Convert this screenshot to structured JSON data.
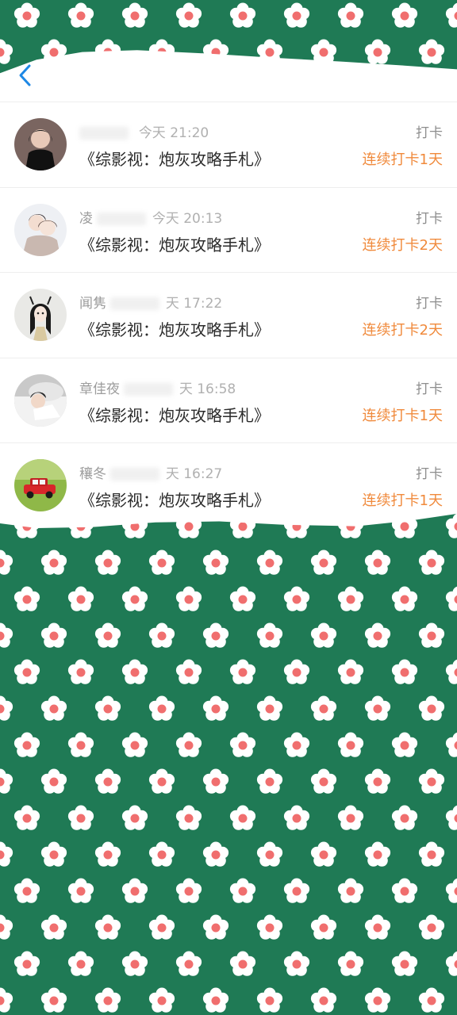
{
  "colors": {
    "background": "#1f7a55",
    "flower_petal": "#ffffff",
    "flower_center": "#f06e6e",
    "accent": "#f08a3c",
    "back_arrow": "#1e88e5"
  },
  "header": {
    "back_icon": "chevron-left-icon"
  },
  "list": [
    {
      "name": "",
      "time": "今天 21:20",
      "book": "《综影视：炮灰攻略手札》",
      "action": "打卡",
      "streak": "连续打卡1天",
      "avatar": "woman-portrait"
    },
    {
      "name": "凌",
      "time": "今天 20:13",
      "book": "《综影视：炮灰攻略手札》",
      "action": "打卡",
      "streak": "连续打卡2天",
      "avatar": "couple-illustration"
    },
    {
      "name": "闻隽",
      "time": "天 17:22",
      "book": "《综影视：炮灰攻略手札》",
      "action": "打卡",
      "streak": "连续打卡2天",
      "avatar": "girl-illustration"
    },
    {
      "name": "章佳夜",
      "time": "天 16:58",
      "book": "《综影视：炮灰攻略手札》",
      "action": "打卡",
      "streak": "连续打卡1天",
      "avatar": "woman-lying-photo"
    },
    {
      "name": "穰冬",
      "time": "天 16:27",
      "book": "《综影视：炮灰攻略手札》",
      "action": "打卡",
      "streak": "连续打卡1天",
      "avatar": "red-car-on-grass"
    }
  ]
}
